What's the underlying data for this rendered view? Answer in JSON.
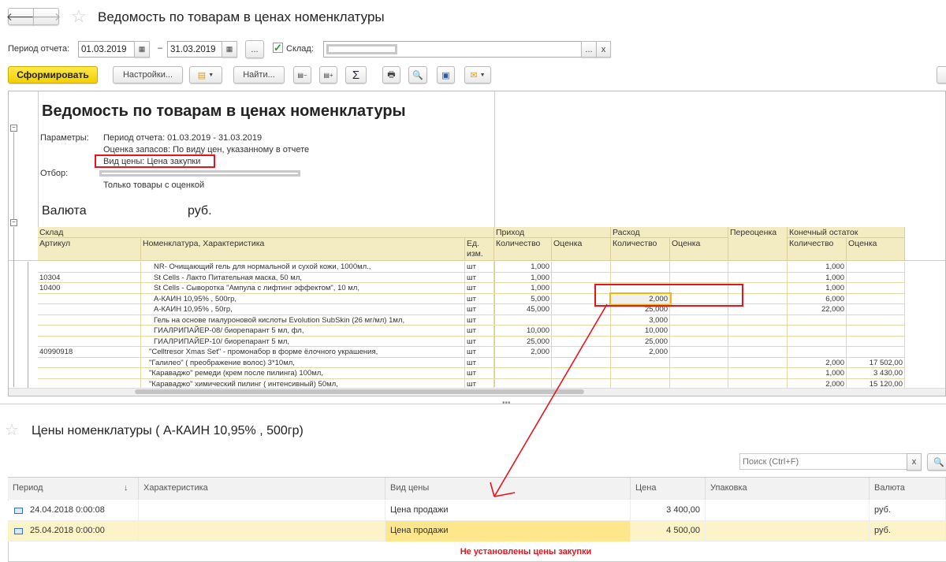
{
  "window": {
    "title": "Ведомость по товарам в ценах номенклатуры"
  },
  "filters": {
    "period_label": "Период отчета:",
    "date_from": "01.03.2019",
    "date_to": "31.03.2019",
    "dash": "–",
    "more": "...",
    "warehouse_label": "Склад:",
    "warehouse_checked": true,
    "clear": "x"
  },
  "toolbar": {
    "generate": "Сформировать",
    "settings": "Настройки...",
    "find": "Найти...",
    "sum": "Σ"
  },
  "report": {
    "title": "Ведомость по товарам в ценах номенклатуры",
    "params_label": "Параметры:",
    "params": [
      "Период отчета: 01.03.2019 - 31.03.2019",
      "Оценка запасов: По виду цен, указанному в отчете",
      "Вид цены: Цена закупки"
    ],
    "filter_label": "Отбор:",
    "filter_note": "Только товары с оценкой",
    "currency_label": "Валюта",
    "currency": "руб.",
    "headers": {
      "warehouse": "Склад",
      "article": "Артикул",
      "item": "Номенклатура, Характеристика",
      "unit": "Ед. изм.",
      "income": "Приход",
      "expense": "Расход",
      "reval": "Переоценка",
      "closing": "Конечный остаток",
      "qty": "Количество",
      "value": "Оценка"
    },
    "rows": [
      [
        "",
        "NR- Очищающий гель для нормальной и сухой кожи, 1000мл.,",
        "шт",
        "1,000",
        "",
        "",
        "",
        "",
        "1,000",
        ""
      ],
      [
        "10304",
        "St Cells - Лакто Питательная маска, 50  мл,",
        "шт",
        "1,000",
        "",
        "",
        "",
        "",
        "1,000",
        ""
      ],
      [
        "10400",
        "St Cells - Сыворотка \"Ампула с лифтинг эффектом\", 10 мл,",
        "шт",
        "1,000",
        "",
        "",
        "",
        "",
        "1,000",
        ""
      ],
      [
        "",
        "А-КАИН 10,95% , 500гр,",
        "шт",
        "5,000",
        "",
        "2,000",
        "",
        "",
        "6,000",
        ""
      ],
      [
        "",
        "А-КАИН 10,95% , 50гр,",
        "шт",
        "45,000",
        "",
        "25,000",
        "",
        "",
        "22,000",
        ""
      ],
      [
        "",
        "Гель на основе гиалуроновой кислоты Evolution SubSkin  (26 мг/мл) 1мл,",
        "шт",
        "",
        "",
        "3,000",
        "",
        "",
        "",
        ""
      ],
      [
        "",
        "ГИАЛРИПАЙЕР-08/ биорепарант 5 мл, фл,",
        "шт",
        "10,000",
        "",
        "10,000",
        "",
        "",
        "",
        ""
      ],
      [
        "",
        "ГИАЛРИПАЙЕР-10/ биорепарант 5 мл,",
        "шт",
        "25,000",
        "",
        "25,000",
        "",
        "",
        "",
        ""
      ],
      [
        "40990918",
        "\"Celltresor Xmas Set\" - промонабор  в форме ёлочного украшения,",
        "шт",
        "2,000",
        "",
        "2,000",
        "",
        "",
        "",
        ""
      ],
      [
        "",
        "\"Галилео\" ( преображение волос) 3*10мл,",
        "шт",
        "",
        "",
        "",
        "",
        "",
        "2,000",
        "17 502,00"
      ],
      [
        "",
        "\"Караваджо\" ремеди (крем после пилинга) 100мл,",
        "шт",
        "",
        "",
        "",
        "",
        "",
        "1,000",
        "3 430,00"
      ],
      [
        "",
        "\"Караваджо\" химический пилинг ( интенсивный) 50мл,",
        "шт",
        "",
        "",
        "",
        "",
        "",
        "2,000",
        "15 120,00"
      ]
    ]
  },
  "prices": {
    "title": "Цены номенклатуры ( А-КАИН 10,95% , 500гр)",
    "search_placeholder": "Поиск (Ctrl+F)",
    "clear": "x",
    "columns": [
      "Период",
      "Характеристика",
      "Вид цены",
      "Цена",
      "Упаковка",
      "Валюта"
    ],
    "sort_icon": "↓",
    "rows": [
      [
        "24.04.2018 0:00:08",
        "",
        "Цена продажи",
        "3 400,00",
        "",
        "руб."
      ],
      [
        "25.04.2018 0:00:00",
        "",
        "Цена продажи",
        "4 500,00",
        "",
        "руб."
      ]
    ],
    "note": "Не установлены цены закупки"
  },
  "colors": {
    "accent": "#f5d800",
    "annotation": "#e8141b",
    "selected_row": "#fdf3c9",
    "selected_cell": "#fde68c"
  }
}
